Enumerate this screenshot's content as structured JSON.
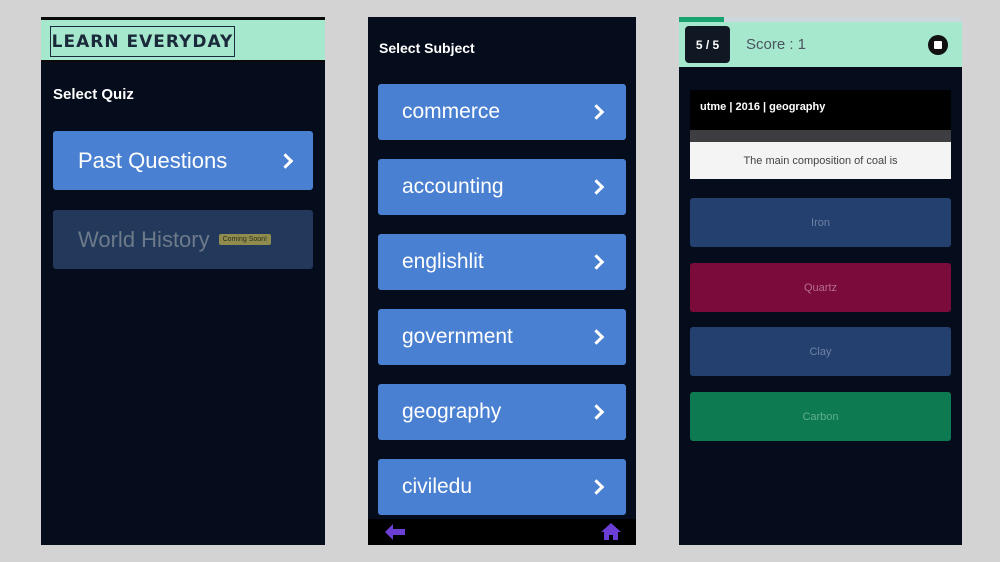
{
  "panel1": {
    "logo": "LEARN EVERYDAY",
    "title": "Select Quiz",
    "quizzes": [
      {
        "label": "Past Questions"
      },
      {
        "label": "World History",
        "badge": "Coming Soon!"
      }
    ]
  },
  "panel2": {
    "title": "Select Subject",
    "subjects": [
      "commerce",
      "accounting",
      "englishlit",
      "government",
      "geography",
      "civiledu"
    ],
    "nav": {
      "back_icon": "arrow-left-icon",
      "home_icon": "home-icon"
    }
  },
  "panel3": {
    "progress": 0.16,
    "counter": "5 / 5",
    "score": "Score : 1",
    "stop_icon": "stop-icon",
    "meta": "utme | 2016 | geography",
    "question": "The main composition of coal is",
    "options": [
      {
        "label": "Iron",
        "color": "#23406e",
        "text_color": "#6e82a6"
      },
      {
        "label": "Quartz",
        "color": "#7a0b3a",
        "text_color": "#b66e8e"
      },
      {
        "label": "Clay",
        "color": "#23406e",
        "text_color": "#6e82a6"
      },
      {
        "label": "Carbon",
        "color": "#0e7a52",
        "text_color": "#5fae8e"
      }
    ]
  },
  "colors": {
    "accent_blue": "#4a80d1",
    "header_mint": "#a6e8ce",
    "screen_bg": "#050c1b",
    "nav_purple": "#6b3fd6"
  }
}
